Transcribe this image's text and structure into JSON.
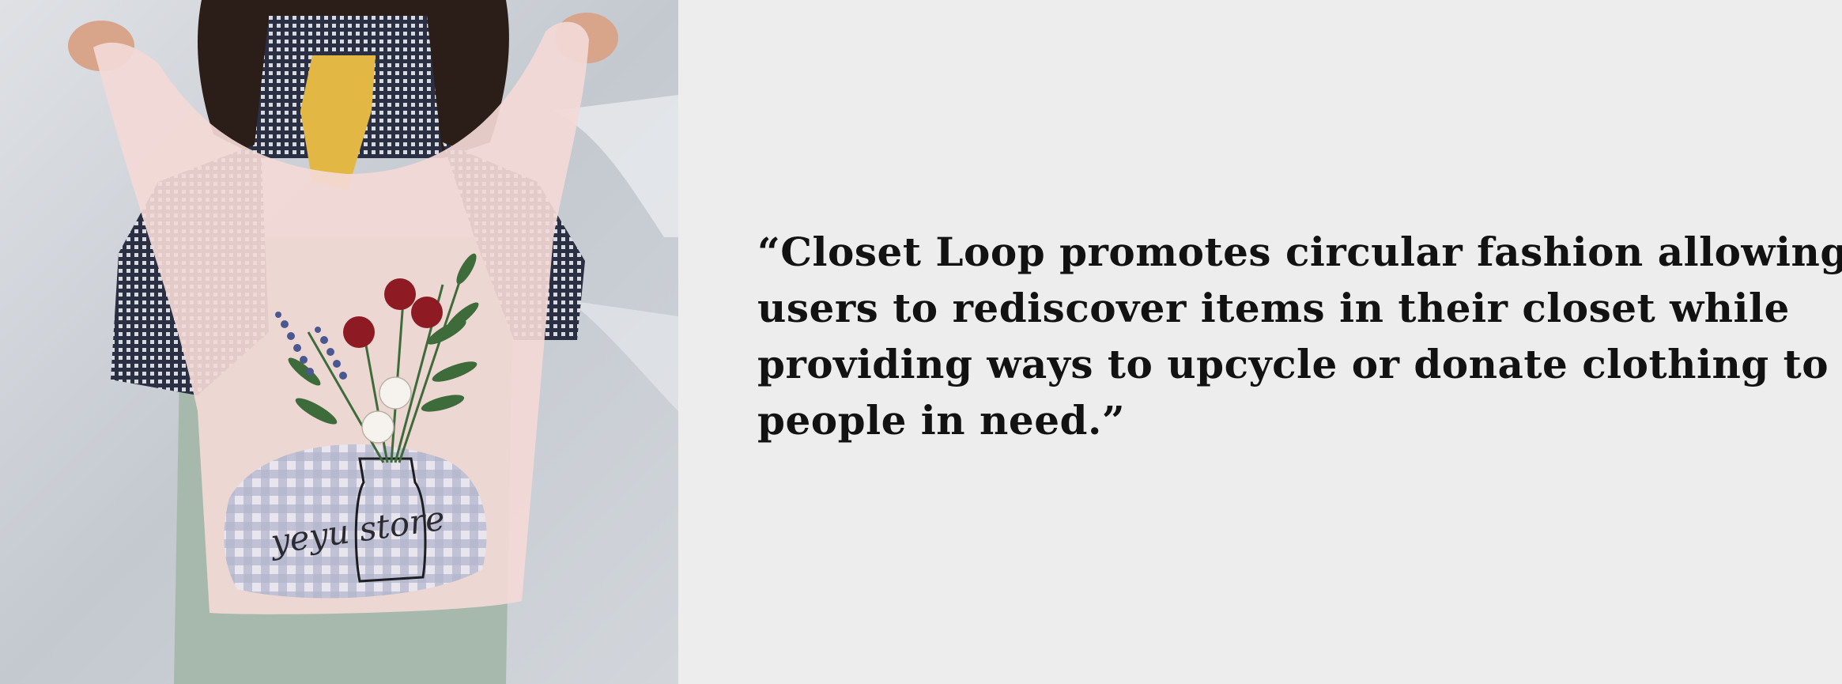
{
  "quote": {
    "lines": [
      "“Closet Loop promotes circular fashion allowing",
      "users to rediscover items in their closet while",
      "providing ways to upcycle or donate clothing to",
      "people in need.”"
    ]
  },
  "photo": {
    "bag_print_text": "yeyu store",
    "colors": {
      "wall": "#c9cdd3",
      "bag": "#f3d9d6",
      "gingham": "#9ea7c6",
      "roses": "#8e1b23",
      "leaves": "#3e6b3a",
      "tie": "#e2b744",
      "shirt": "#2e3247",
      "overall": "#a7b8ac",
      "skin": "#d8a48a",
      "hair": "#2b1d17"
    }
  },
  "colors": {
    "background": "#ededed",
    "text": "#121212"
  }
}
